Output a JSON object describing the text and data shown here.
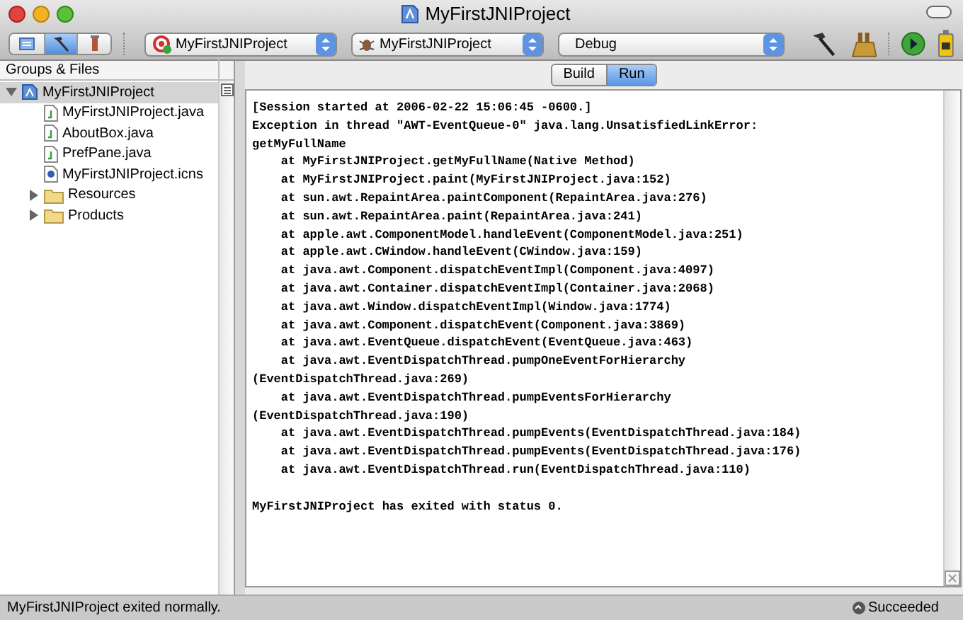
{
  "window": {
    "title": "MyFirstJNIProject"
  },
  "toolbar": {
    "view_modes": [
      {
        "kind": "page",
        "selected": false
      },
      {
        "kind": "hammer",
        "selected": true
      },
      {
        "kind": "paint",
        "selected": false
      }
    ],
    "popups": [
      {
        "kind": "target",
        "value": "MyFirstJNIProject"
      },
      {
        "kind": "bug",
        "value": "MyFirstJNIProject"
      },
      {
        "kind": "plain",
        "value": "Debug"
      }
    ]
  },
  "sidebar": {
    "header": "Groups & Files",
    "tree": [
      {
        "label": "MyFirstJNIProject",
        "kind": "project",
        "expanded": true,
        "selected": true,
        "children": [
          {
            "label": "MyFirstJNIProject.java",
            "kind": "java",
            "selected": false
          },
          {
            "label": "AboutBox.java",
            "kind": "java",
            "selected": false
          },
          {
            "label": "PrefPane.java",
            "kind": "java",
            "selected": false
          },
          {
            "label": "MyFirstJNIProject.icns",
            "kind": "icns",
            "selected": false
          },
          {
            "label": "Resources",
            "kind": "folder",
            "expanded": false,
            "selected": false
          },
          {
            "label": "Products",
            "kind": "folder",
            "expanded": false,
            "selected": false
          }
        ]
      }
    ]
  },
  "tabs": [
    {
      "label": "Build",
      "selected": false
    },
    {
      "label": "Run",
      "selected": true
    }
  ],
  "console": {
    "lines": [
      {
        "kind": "text",
        "text": "[Session started at 2006-02-22 15:06:45 -0600.]"
      },
      {
        "kind": "text",
        "text": "Exception in thread \"AWT-EventQueue-0\" java.lang.UnsatisfiedLinkError:"
      },
      {
        "kind": "text",
        "text": "getMyFullName"
      },
      {
        "kind": "frame",
        "text": "at MyFirstJNIProject.getMyFullName(Native Method)"
      },
      {
        "kind": "frame",
        "text": "at MyFirstJNIProject.paint(MyFirstJNIProject.java:152)"
      },
      {
        "kind": "frame",
        "text": "at sun.awt.RepaintArea.paintComponent(RepaintArea.java:276)"
      },
      {
        "kind": "frame",
        "text": "at sun.awt.RepaintArea.paint(RepaintArea.java:241)"
      },
      {
        "kind": "frame",
        "text": "at apple.awt.ComponentModel.handleEvent(ComponentModel.java:251)"
      },
      {
        "kind": "frame",
        "text": "at apple.awt.CWindow.handleEvent(CWindow.java:159)"
      },
      {
        "kind": "frame",
        "text": "at java.awt.Component.dispatchEventImpl(Component.java:4097)"
      },
      {
        "kind": "frame",
        "text": "at java.awt.Container.dispatchEventImpl(Container.java:2068)"
      },
      {
        "kind": "frame",
        "text": "at java.awt.Window.dispatchEventImpl(Window.java:1774)"
      },
      {
        "kind": "frame",
        "text": "at java.awt.Component.dispatchEvent(Component.java:3869)"
      },
      {
        "kind": "frame",
        "text": "at java.awt.EventQueue.dispatchEvent(EventQueue.java:463)"
      },
      {
        "kind": "frame",
        "text": "at java.awt.EventDispatchThread.pumpOneEventForHierarchy"
      },
      {
        "kind": "text",
        "text": "(EventDispatchThread.java:269)"
      },
      {
        "kind": "frame",
        "text": "at java.awt.EventDispatchThread.pumpEventsForHierarchy"
      },
      {
        "kind": "text",
        "text": "(EventDispatchThread.java:190)"
      },
      {
        "kind": "frame",
        "text": "at java.awt.EventDispatchThread.pumpEvents(EventDispatchThread.java:184)"
      },
      {
        "kind": "frame",
        "text": "at java.awt.EventDispatchThread.pumpEvents(EventDispatchThread.java:176)"
      },
      {
        "kind": "frame",
        "text": "at java.awt.EventDispatchThread.run(EventDispatchThread.java:110)"
      },
      {
        "kind": "status",
        "text": "MyFirstJNIProject has exited with status 0."
      }
    ]
  },
  "status_bar": {
    "message": "MyFirstJNIProject exited normally.",
    "result": "Succeeded"
  }
}
